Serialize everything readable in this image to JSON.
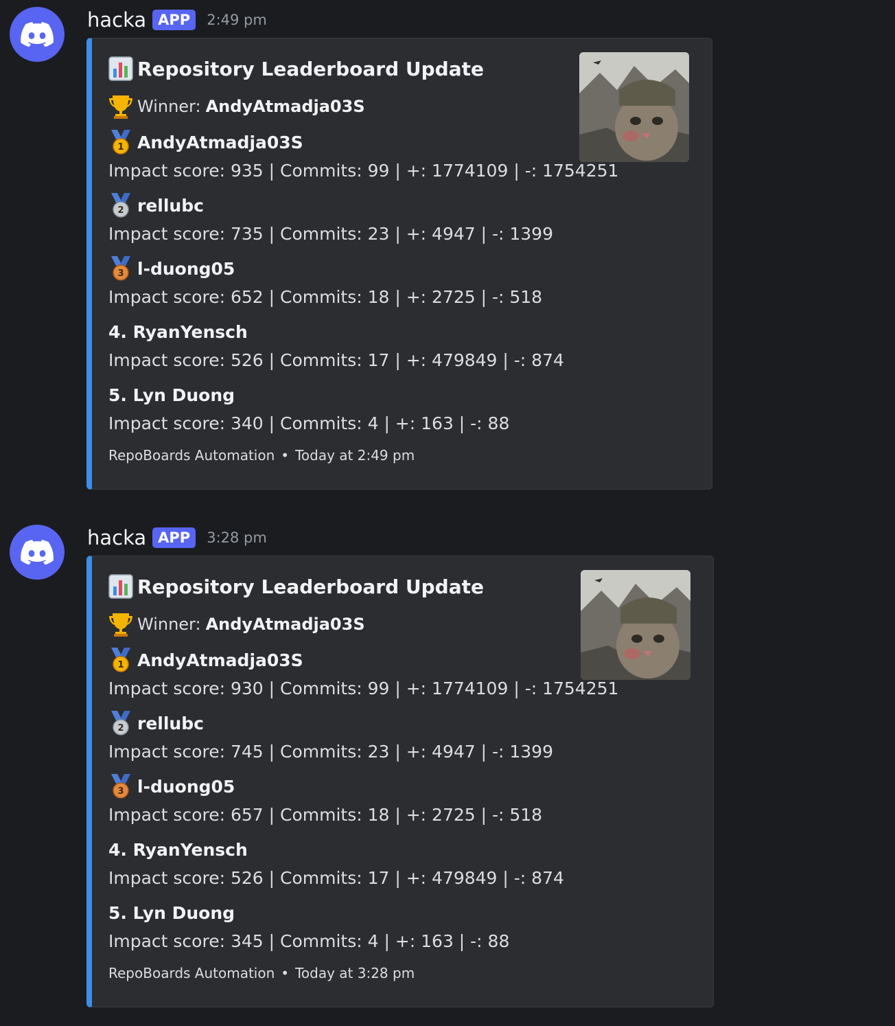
{
  "messages": [
    {
      "author": "hacka",
      "badge": "APP",
      "time": "2:49 pm",
      "embed": {
        "title": "Repository Leaderboard Update",
        "winner_label": "Winner:",
        "winner_name": "AndyAtmadja03S",
        "entries": [
          {
            "rank_marker": "1st-place-medal",
            "name": "AndyAtmadja03S",
            "stats": "Impact score: 935 | Commits: 99 | +: 1774109 | -: 1754251"
          },
          {
            "rank_marker": "2nd-place-medal",
            "name": "rellubc",
            "stats": "Impact score: 735 | Commits: 23 | +: 4947 | -: 1399"
          },
          {
            "rank_marker": "3rd-place-medal",
            "name": "l-duong05",
            "stats": "Impact score: 652 | Commits: 18 | +: 2725 | -: 518"
          },
          {
            "rank_marker": "",
            "name": "4. RyanYensch",
            "stats": "Impact score: 526 | Commits: 17 | +: 479849 | -: 874"
          },
          {
            "rank_marker": "",
            "name": "5. Lyn Duong",
            "stats": "Impact score: 340 | Commits: 4 | +: 163 | -: 88"
          }
        ],
        "footer_source": "RepoBoards Automation",
        "footer_time": "Today at 2:49 pm"
      }
    },
    {
      "author": "hacka",
      "badge": "APP",
      "time": "3:28 pm",
      "embed": {
        "title": "Repository Leaderboard Update",
        "winner_label": "Winner:",
        "winner_name": "AndyAtmadja03S",
        "entries": [
          {
            "rank_marker": "1st-place-medal",
            "name": "AndyAtmadja03S",
            "stats": "Impact score: 930 | Commits: 99 | +: 1774109 | -: 1754251"
          },
          {
            "rank_marker": "2nd-place-medal",
            "name": "rellubc",
            "stats": "Impact score: 745 | Commits: 23 | +: 4947 | -: 1399"
          },
          {
            "rank_marker": "3rd-place-medal",
            "name": "l-duong05",
            "stats": "Impact score: 657 | Commits: 18 | +: 2725 | -: 518"
          },
          {
            "rank_marker": "",
            "name": "4. RyanYensch",
            "stats": "Impact score: 526 | Commits: 17 | +: 479849 | -: 874"
          },
          {
            "rank_marker": "",
            "name": "5. Lyn Duong",
            "stats": "Impact score: 345 | Commits: 4 | +: 163 | -: 88"
          }
        ],
        "footer_source": "RepoBoards Automation",
        "footer_time": "Today at 3:28 pm"
      }
    }
  ],
  "colors": {
    "background": "#1b1c1f",
    "embed_background": "#2b2d31",
    "embed_accent": "#3d8fe6",
    "blurple": "#5865f2"
  },
  "icons": [
    "discord-logo-icon",
    "bar-chart-icon",
    "trophy-icon",
    "1st-place-medal-icon",
    "2nd-place-medal-icon",
    "3rd-place-medal-icon"
  ]
}
